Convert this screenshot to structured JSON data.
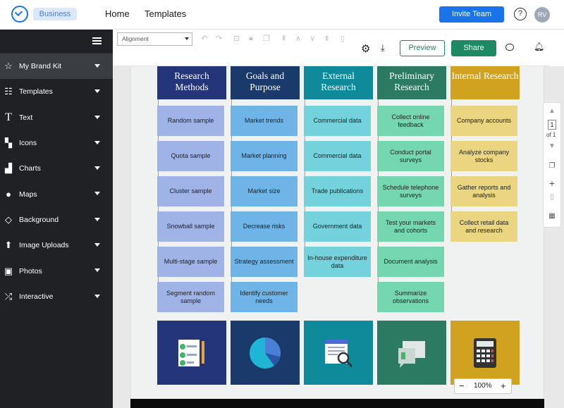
{
  "header": {
    "badge": "Business",
    "nav": [
      "Home",
      "Templates"
    ],
    "invite_label": "Invite Team",
    "help_icon": "?",
    "avatar_initials": "RV"
  },
  "sidebar": {
    "items": [
      {
        "label": "My Brand Kit",
        "icon": "star-icon"
      },
      {
        "label": "Templates",
        "icon": "templates-icon"
      },
      {
        "label": "Text",
        "icon": "text-icon"
      },
      {
        "label": "Icons",
        "icon": "icons-icon"
      },
      {
        "label": "Charts",
        "icon": "chart-icon"
      },
      {
        "label": "Maps",
        "icon": "globe-icon"
      },
      {
        "label": "Background",
        "icon": "bucket-icon"
      },
      {
        "label": "Image Uploads",
        "icon": "upload-icon"
      },
      {
        "label": "Photos",
        "icon": "photo-icon"
      },
      {
        "label": "Interactive",
        "icon": "shuffle-icon"
      }
    ]
  },
  "toolbar": {
    "alignment_placeholder": "Alignment",
    "preview_label": "Preview",
    "share_label": "Share"
  },
  "canvas": {
    "columns": [
      {
        "title": "Research Methods",
        "color": "#24357a",
        "box_color": "#9fb3e6",
        "items": [
          "Random sample",
          "Quota sample",
          "Cluster sample",
          "Snowball sample",
          "Multi-stage sample",
          "Segment random sample"
        ]
      },
      {
        "title": "Goals and Purpose",
        "color": "#1a3a6b",
        "box_color": "#6fb4e6",
        "items": [
          "Market trends",
          "Market planning",
          "Market size",
          "Decrease risks",
          "Strategy assessment",
          "Identify customer needs"
        ]
      },
      {
        "title": "External Research",
        "color": "#0e8a9a",
        "box_color": "#74d2dc",
        "items": [
          "Commercial data",
          "Commercial data",
          "Trade publications",
          "Government data",
          "In-house expenditure data"
        ]
      },
      {
        "title": "Preliminary Research",
        "color": "#2d7a62",
        "box_color": "#74d7b2",
        "items": [
          "Collect online feedback",
          "Conduct portal surveys",
          "Schedule telephone surveys",
          "Test your markets and cohorts",
          "Document analysis",
          "Summarize observations"
        ]
      },
      {
        "title": "Internal Research",
        "color": "#d1a21f",
        "box_color": "#ead580",
        "items": [
          "Company accounts",
          "Analyze company stocks",
          "Gather reports and analysis",
          "Collect retail data and research"
        ]
      }
    ]
  },
  "pager": {
    "current": "1",
    "total": "of 1"
  },
  "zoom": {
    "level": "100%",
    "minus": "−",
    "plus": "+"
  }
}
